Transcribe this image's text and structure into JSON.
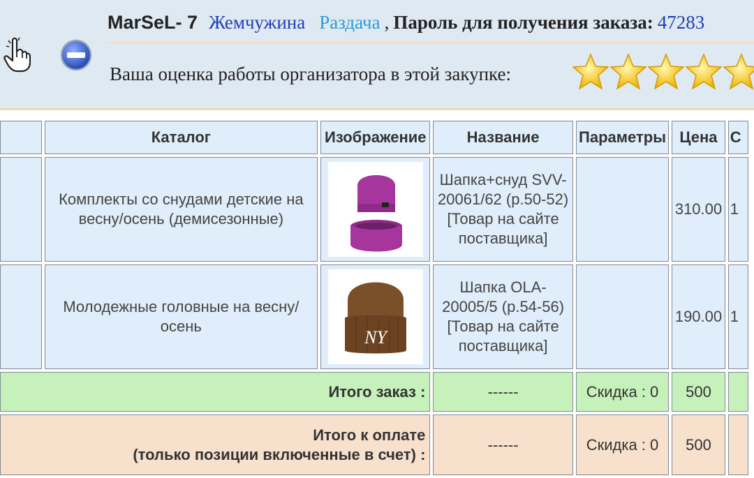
{
  "header": {
    "nickname": "MarSeL- 7",
    "link1": "Жемчужина",
    "link2": "Раздача",
    "comma": ",",
    "password_label": "Пароль для получения заказа:",
    "password_value": "47283",
    "rating_label": "Ваша оценка работы организатора в этой закупке:",
    "stars": 5
  },
  "table": {
    "headers": [
      "",
      "Каталог",
      "Изображение",
      "Название",
      "Параметры",
      "Цена",
      "С"
    ],
    "rows": [
      {
        "catalog": "Комплекты со снудами детские на весну/осень (демисезонные)",
        "name": "Шапка+снуд SVV-20061/62 (р.50-52)",
        "link": "[Товар на сайте поставщика]",
        "params": "",
        "price": "310.00",
        "extra": "1",
        "image": "purple-hat-snood"
      },
      {
        "catalog": "Молодежные головные на весну/осень",
        "name": "Шапка OLA-20005/5 (р.54-56)",
        "link": "[Товар на сайте поставщика]",
        "params": "",
        "price": "190.00",
        "extra": "1",
        "image": "brown-ny-beanie"
      }
    ],
    "total": {
      "label": "Итого заказ :",
      "dashes": "------",
      "discount": "Скидка : 0",
      "amount": "500"
    },
    "pay": {
      "label1": "Итого к оплате",
      "label2": "(только позиции включенные в счет) :",
      "dashes": "------",
      "discount": "Скидка : 0",
      "amount": "500"
    }
  },
  "colors": {
    "header_bg": "#dfe9f2",
    "cell_bg": "#dfeefa",
    "total_bg": "#c7f1bb",
    "pay_bg": "#f7e0cc",
    "link_dark": "#1f3fb5",
    "link_light": "#2a9bd8"
  }
}
